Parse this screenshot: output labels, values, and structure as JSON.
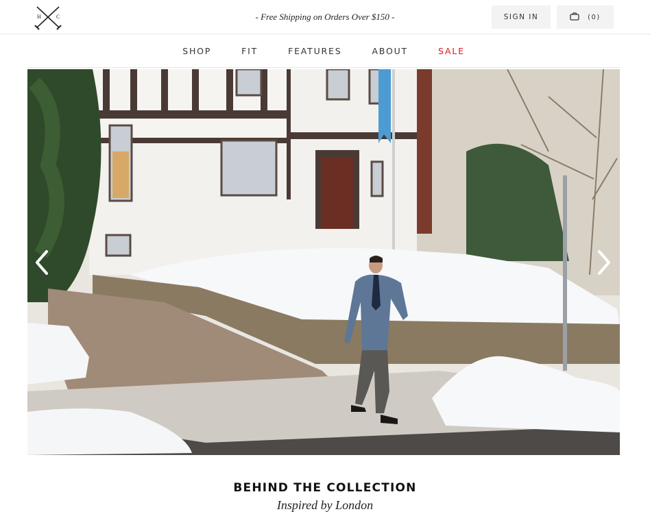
{
  "header": {
    "logo_letters": [
      "H",
      "C"
    ],
    "shipping_banner": "- Free Shipping on Orders Over $150 -",
    "signin_label": "SIGN IN",
    "cart_count": "(0)"
  },
  "nav": {
    "items": [
      {
        "label": "SHOP"
      },
      {
        "label": "FIT"
      },
      {
        "label": "FEATURES"
      },
      {
        "label": "ABOUT"
      },
      {
        "label": "SALE"
      }
    ],
    "sale_color": "#e0141e"
  },
  "hero": {
    "alt": "hero-slideshow",
    "prev_icon": "chevron-left-icon",
    "next_icon": "chevron-right-icon"
  },
  "section": {
    "title": "BEHIND THE COLLECTION",
    "subtitle": "Inspired by London"
  }
}
